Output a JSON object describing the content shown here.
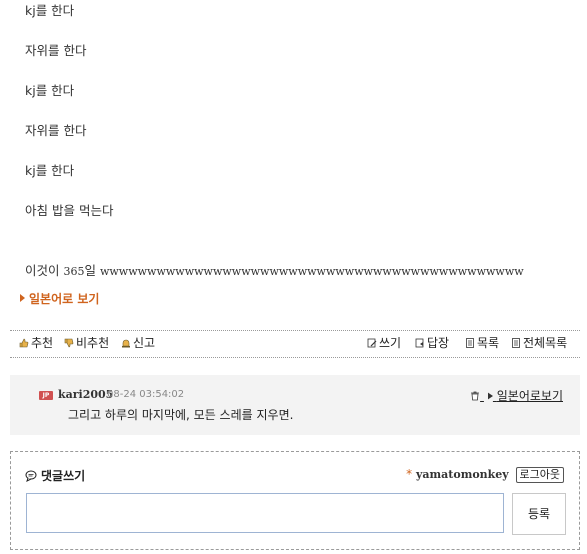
{
  "post": {
    "lines": [
      "kj를 한다",
      "자위를 한다",
      "kj를 한다",
      "자위를 한다",
      "kj를 한다",
      "아침 밥을 먹는다"
    ],
    "last_line_prefix": "이것이 ",
    "last_line_num": "365",
    "last_line_suffix": "일 ",
    "last_line_w": "wwwwwwwwwwwwwwwwwwwwwwwwwwwwwwwwwwwwwwwwwwwww"
  },
  "jp_link": "일본어로 보기",
  "toolbar": {
    "recommend": "추천",
    "not_recommend": "비추천",
    "report": "신고",
    "write": "쓰기",
    "reply": "답장",
    "list": "목록",
    "all_list": "전체목록"
  },
  "comment": {
    "badge": "JP",
    "author": "kari2005",
    "date": "08-24 03:54:02",
    "text": "그리고 하루의 마지막에, 모든 스레를 지우면.",
    "action": "일본어로보기"
  },
  "reply_form": {
    "title": "댓글쓰기",
    "star": "*",
    "username": "yamatomonkey",
    "logout": "로그아웃",
    "submit": "등록",
    "input_value": ""
  },
  "colors": {
    "accent": "#d0641e",
    "badge": "#d05050",
    "comment_bg": "#f3f3f3",
    "input_border": "#9eb4d3"
  }
}
